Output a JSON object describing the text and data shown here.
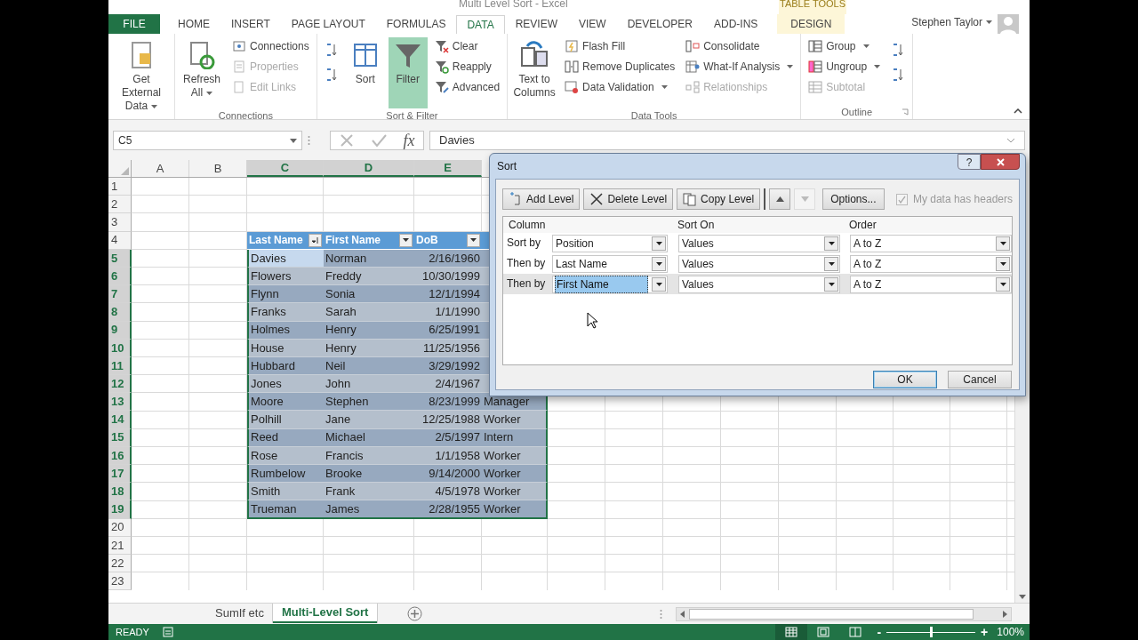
{
  "window": {
    "title": "Multi Level Sort - Excel",
    "context_group": "TABLE TOOLS"
  },
  "tabs": [
    {
      "label": "FILE",
      "kind": "file",
      "selected": false
    },
    {
      "label": "HOME",
      "kind": "normal",
      "selected": false
    },
    {
      "label": "INSERT",
      "kind": "normal",
      "selected": false
    },
    {
      "label": "PAGE LAYOUT",
      "kind": "normal",
      "selected": false
    },
    {
      "label": "FORMULAS",
      "kind": "normal",
      "selected": false
    },
    {
      "label": "DATA",
      "kind": "normal",
      "selected": true
    },
    {
      "label": "REVIEW",
      "kind": "normal",
      "selected": false
    },
    {
      "label": "VIEW",
      "kind": "normal",
      "selected": false
    },
    {
      "label": "DEVELOPER",
      "kind": "normal",
      "selected": false
    },
    {
      "label": "ADD-INS",
      "kind": "normal",
      "selected": false
    },
    {
      "label": "DESIGN",
      "kind": "context",
      "selected": false
    }
  ],
  "user": {
    "name": "Stephen Taylor"
  },
  "ribbon": [
    {
      "launcher": false,
      "items": [
        {
          "kind": "large",
          "label": "Get External Data",
          "dropdown": true,
          "disabled": false,
          "on": false
        }
      ]
    },
    {
      "label": "Connections",
      "launcher": false,
      "items": [
        {
          "kind": "large",
          "label": "Refresh All",
          "dropdown": true,
          "disabled": false,
          "on": false
        },
        {
          "kind": "small",
          "label": "Connections",
          "dropdown": false,
          "disabled": false,
          "on": false
        },
        {
          "kind": "small",
          "label": "Properties",
          "dropdown": false,
          "disabled": true,
          "on": false
        },
        {
          "kind": "small",
          "label": "Edit Links",
          "dropdown": false,
          "disabled": true,
          "on": false
        }
      ]
    },
    {
      "label": "Sort & Filter",
      "launcher": false,
      "items": [
        {
          "kind": "sort-pair"
        },
        {
          "kind": "large",
          "label": "Sort",
          "dropdown": false,
          "disabled": false,
          "on": false
        },
        {
          "kind": "large",
          "label": "Filter",
          "dropdown": false,
          "disabled": false,
          "on": true
        },
        {
          "kind": "small",
          "label": "Clear",
          "dropdown": false,
          "disabled": false,
          "on": false
        },
        {
          "kind": "small",
          "label": "Reapply",
          "dropdown": false,
          "disabled": false,
          "on": false
        },
        {
          "kind": "small",
          "label": "Advanced",
          "dropdown": false,
          "disabled": false,
          "on": false
        }
      ]
    },
    {
      "label": "Data Tools",
      "launcher": false,
      "items": [
        {
          "kind": "large",
          "label": "Text to Columns",
          "dropdown": false,
          "disabled": false,
          "on": false
        },
        {
          "kind": "small",
          "label": "Flash Fill",
          "dropdown": false,
          "disabled": false,
          "on": false
        },
        {
          "kind": "small",
          "label": "Remove Duplicates",
          "dropdown": false,
          "disabled": false,
          "on": false
        },
        {
          "kind": "small",
          "label": "Data Validation",
          "dropdown": true,
          "disabled": false,
          "on": false
        },
        {
          "kind": "small",
          "label": "Consolidate",
          "dropdown": false,
          "disabled": false,
          "on": false
        },
        {
          "kind": "small",
          "label": "What-If Analysis",
          "dropdown": true,
          "disabled": false,
          "on": false
        },
        {
          "kind": "small",
          "label": "Relationships",
          "dropdown": false,
          "disabled": true,
          "on": false
        }
      ]
    },
    {
      "label": "Outline",
      "launcher": true,
      "items": [
        {
          "kind": "small",
          "label": "Group",
          "dropdown": true,
          "disabled": false,
          "on": false
        },
        {
          "kind": "small",
          "label": "Ungroup",
          "dropdown": true,
          "disabled": false,
          "on": false
        },
        {
          "kind": "small",
          "label": "Subtotal",
          "dropdown": false,
          "disabled": true,
          "on": false
        },
        {
          "kind": "detail-pair"
        }
      ]
    }
  ],
  "formula_bar": {
    "name_box": "C5",
    "fx": "fx",
    "value": "Davies"
  },
  "sheet": {
    "columns": [
      {
        "label": "A",
        "selected": false
      },
      {
        "label": "B",
        "selected": false
      },
      {
        "label": "C",
        "selected": true
      },
      {
        "label": "D",
        "selected": true
      },
      {
        "label": "E",
        "selected": true
      }
    ],
    "rows": [
      {
        "label": "1",
        "selected": false
      },
      {
        "label": "2",
        "selected": false
      },
      {
        "label": "3",
        "selected": false
      },
      {
        "label": "4",
        "selected": false
      },
      {
        "label": "5",
        "selected": true
      },
      {
        "label": "6",
        "selected": true
      },
      {
        "label": "7",
        "selected": true
      },
      {
        "label": "8",
        "selected": true
      },
      {
        "label": "9",
        "selected": true
      },
      {
        "label": "10",
        "selected": true
      },
      {
        "label": "11",
        "selected": true
      },
      {
        "label": "12",
        "selected": true
      },
      {
        "label": "13",
        "selected": true
      },
      {
        "label": "14",
        "selected": true
      },
      {
        "label": "15",
        "selected": true
      },
      {
        "label": "16",
        "selected": true
      },
      {
        "label": "17",
        "selected": true
      },
      {
        "label": "18",
        "selected": true
      },
      {
        "label": "19",
        "selected": true
      },
      {
        "label": "20",
        "selected": false
      },
      {
        "label": "21",
        "selected": false
      },
      {
        "label": "22",
        "selected": false
      },
      {
        "label": "23",
        "selected": false
      }
    ]
  },
  "table": {
    "headers": [
      {
        "label": "Last Name",
        "sorted": true
      },
      {
        "label": "First Name",
        "sorted": false
      },
      {
        "label": "DoB",
        "sorted": false
      }
    ],
    "rows": [
      {
        "active": true,
        "cells": [
          "Davies",
          "Norman",
          "2/16/1960"
        ]
      },
      {
        "active": false,
        "cells": [
          "Flowers",
          "Freddy",
          "10/30/1999"
        ]
      },
      {
        "active": false,
        "cells": [
          "Flynn",
          "Sonia",
          "12/1/1994"
        ]
      },
      {
        "active": false,
        "cells": [
          "Franks",
          "Sarah",
          "1/1/1990"
        ]
      },
      {
        "active": false,
        "cells": [
          "Holmes",
          "Henry",
          "6/25/1991"
        ]
      },
      {
        "active": false,
        "cells": [
          "House",
          "Henry",
          "11/25/1956"
        ]
      },
      {
        "active": false,
        "cells": [
          "Hubbard",
          "Neil",
          "3/29/1992"
        ]
      },
      {
        "active": false,
        "cells": [
          "Jones",
          "John",
          "2/4/1967"
        ]
      },
      {
        "active": false,
        "cells": [
          "Moore",
          "Stephen",
          "8/23/1999",
          "Manager"
        ]
      },
      {
        "active": false,
        "cells": [
          "Polhill",
          "Jane",
          "12/25/1988",
          "Worker"
        ]
      },
      {
        "active": false,
        "cells": [
          "Reed",
          "Michael",
          "2/5/1997",
          "Intern"
        ]
      },
      {
        "active": false,
        "cells": [
          "Rose",
          "Francis",
          "1/1/1958",
          "Worker"
        ]
      },
      {
        "active": false,
        "cells": [
          "Rumbelow",
          "Brooke",
          "9/14/2000",
          "Worker"
        ]
      },
      {
        "active": false,
        "cells": [
          "Smith",
          "Frank",
          "4/5/1978",
          "Worker"
        ]
      },
      {
        "active": false,
        "cells": [
          "Trueman",
          "James",
          "2/28/1955",
          "Worker"
        ]
      }
    ]
  },
  "sheet_tabs": [
    {
      "label": "SumIf etc",
      "selected": false
    },
    {
      "label": "Multi-Level Sort",
      "selected": true
    }
  ],
  "status_bar": {
    "mode": "READY",
    "views": [
      {
        "selected": true
      },
      {
        "selected": false
      },
      {
        "selected": false
      }
    ],
    "zoom_out": "-",
    "zoom_in": "+",
    "zoom": {
      "level": 0.5
    },
    "zoom_label": "100%"
  },
  "dialog": {
    "title": "Sort",
    "help": "?",
    "toolbar": [
      {
        "label": "Add Level",
        "disabled": false
      },
      {
        "label": "Delete Level",
        "disabled": false
      },
      {
        "label": "Copy Level",
        "disabled": false
      }
    ],
    "move_up": {
      "disabled": false
    },
    "move_down": {
      "disabled": true
    },
    "options": "Options...",
    "headers_checkbox": {
      "label": "My data has headers",
      "checked": true,
      "disabled": true
    },
    "columns": [
      "Column",
      "Sort On",
      "Order"
    ],
    "levels": [
      {
        "label": "Sort by",
        "column": "Position",
        "sort_on": "Values",
        "order": "A to Z",
        "selected": false
      },
      {
        "label": "Then by",
        "column": "Last Name",
        "sort_on": "Values",
        "order": "A to Z",
        "selected": false
      },
      {
        "label": "Then by",
        "column": "First Name",
        "sort_on": "Values",
        "order": "A to Z",
        "selected": true
      }
    ],
    "buttons": [
      "OK",
      "Cancel"
    ]
  }
}
